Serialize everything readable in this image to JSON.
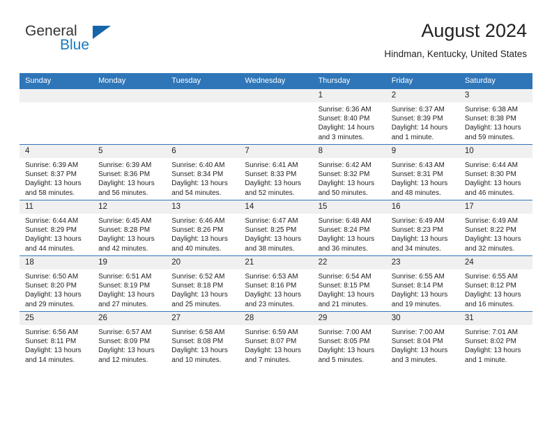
{
  "brand": {
    "name_part1": "General",
    "name_part2": "Blue",
    "triangle_color": "#1565a8",
    "blue_text_color": "#1878be"
  },
  "header": {
    "month_title": "August 2024",
    "location": "Hindman, Kentucky, United States",
    "accent_color": "#2f76b8",
    "daynum_band_color": "#f0f0f0"
  },
  "weekday_headers": [
    "Sunday",
    "Monday",
    "Tuesday",
    "Wednesday",
    "Thursday",
    "Friday",
    "Saturday"
  ],
  "labels": {
    "sunrise_prefix": "Sunrise:",
    "sunset_prefix": "Sunset:",
    "daylight_prefix": "Daylight:"
  },
  "weeks": [
    [
      {
        "day": "",
        "sunrise": "",
        "sunset": "",
        "daylight_line1": "",
        "daylight_line2": ""
      },
      {
        "day": "",
        "sunrise": "",
        "sunset": "",
        "daylight_line1": "",
        "daylight_line2": ""
      },
      {
        "day": "",
        "sunrise": "",
        "sunset": "",
        "daylight_line1": "",
        "daylight_line2": ""
      },
      {
        "day": "",
        "sunrise": "",
        "sunset": "",
        "daylight_line1": "",
        "daylight_line2": ""
      },
      {
        "day": "1",
        "sunrise": "Sunrise: 6:36 AM",
        "sunset": "Sunset: 8:40 PM",
        "daylight_line1": "Daylight: 14 hours",
        "daylight_line2": "and 3 minutes."
      },
      {
        "day": "2",
        "sunrise": "Sunrise: 6:37 AM",
        "sunset": "Sunset: 8:39 PM",
        "daylight_line1": "Daylight: 14 hours",
        "daylight_line2": "and 1 minute."
      },
      {
        "day": "3",
        "sunrise": "Sunrise: 6:38 AM",
        "sunset": "Sunset: 8:38 PM",
        "daylight_line1": "Daylight: 13 hours",
        "daylight_line2": "and 59 minutes."
      }
    ],
    [
      {
        "day": "4",
        "sunrise": "Sunrise: 6:39 AM",
        "sunset": "Sunset: 8:37 PM",
        "daylight_line1": "Daylight: 13 hours",
        "daylight_line2": "and 58 minutes."
      },
      {
        "day": "5",
        "sunrise": "Sunrise: 6:39 AM",
        "sunset": "Sunset: 8:36 PM",
        "daylight_line1": "Daylight: 13 hours",
        "daylight_line2": "and 56 minutes."
      },
      {
        "day": "6",
        "sunrise": "Sunrise: 6:40 AM",
        "sunset": "Sunset: 8:34 PM",
        "daylight_line1": "Daylight: 13 hours",
        "daylight_line2": "and 54 minutes."
      },
      {
        "day": "7",
        "sunrise": "Sunrise: 6:41 AM",
        "sunset": "Sunset: 8:33 PM",
        "daylight_line1": "Daylight: 13 hours",
        "daylight_line2": "and 52 minutes."
      },
      {
        "day": "8",
        "sunrise": "Sunrise: 6:42 AM",
        "sunset": "Sunset: 8:32 PM",
        "daylight_line1": "Daylight: 13 hours",
        "daylight_line2": "and 50 minutes."
      },
      {
        "day": "9",
        "sunrise": "Sunrise: 6:43 AM",
        "sunset": "Sunset: 8:31 PM",
        "daylight_line1": "Daylight: 13 hours",
        "daylight_line2": "and 48 minutes."
      },
      {
        "day": "10",
        "sunrise": "Sunrise: 6:44 AM",
        "sunset": "Sunset: 8:30 PM",
        "daylight_line1": "Daylight: 13 hours",
        "daylight_line2": "and 46 minutes."
      }
    ],
    [
      {
        "day": "11",
        "sunrise": "Sunrise: 6:44 AM",
        "sunset": "Sunset: 8:29 PM",
        "daylight_line1": "Daylight: 13 hours",
        "daylight_line2": "and 44 minutes."
      },
      {
        "day": "12",
        "sunrise": "Sunrise: 6:45 AM",
        "sunset": "Sunset: 8:28 PM",
        "daylight_line1": "Daylight: 13 hours",
        "daylight_line2": "and 42 minutes."
      },
      {
        "day": "13",
        "sunrise": "Sunrise: 6:46 AM",
        "sunset": "Sunset: 8:26 PM",
        "daylight_line1": "Daylight: 13 hours",
        "daylight_line2": "and 40 minutes."
      },
      {
        "day": "14",
        "sunrise": "Sunrise: 6:47 AM",
        "sunset": "Sunset: 8:25 PM",
        "daylight_line1": "Daylight: 13 hours",
        "daylight_line2": "and 38 minutes."
      },
      {
        "day": "15",
        "sunrise": "Sunrise: 6:48 AM",
        "sunset": "Sunset: 8:24 PM",
        "daylight_line1": "Daylight: 13 hours",
        "daylight_line2": "and 36 minutes."
      },
      {
        "day": "16",
        "sunrise": "Sunrise: 6:49 AM",
        "sunset": "Sunset: 8:23 PM",
        "daylight_line1": "Daylight: 13 hours",
        "daylight_line2": "and 34 minutes."
      },
      {
        "day": "17",
        "sunrise": "Sunrise: 6:49 AM",
        "sunset": "Sunset: 8:22 PM",
        "daylight_line1": "Daylight: 13 hours",
        "daylight_line2": "and 32 minutes."
      }
    ],
    [
      {
        "day": "18",
        "sunrise": "Sunrise: 6:50 AM",
        "sunset": "Sunset: 8:20 PM",
        "daylight_line1": "Daylight: 13 hours",
        "daylight_line2": "and 29 minutes."
      },
      {
        "day": "19",
        "sunrise": "Sunrise: 6:51 AM",
        "sunset": "Sunset: 8:19 PM",
        "daylight_line1": "Daylight: 13 hours",
        "daylight_line2": "and 27 minutes."
      },
      {
        "day": "20",
        "sunrise": "Sunrise: 6:52 AM",
        "sunset": "Sunset: 8:18 PM",
        "daylight_line1": "Daylight: 13 hours",
        "daylight_line2": "and 25 minutes."
      },
      {
        "day": "21",
        "sunrise": "Sunrise: 6:53 AM",
        "sunset": "Sunset: 8:16 PM",
        "daylight_line1": "Daylight: 13 hours",
        "daylight_line2": "and 23 minutes."
      },
      {
        "day": "22",
        "sunrise": "Sunrise: 6:54 AM",
        "sunset": "Sunset: 8:15 PM",
        "daylight_line1": "Daylight: 13 hours",
        "daylight_line2": "and 21 minutes."
      },
      {
        "day": "23",
        "sunrise": "Sunrise: 6:55 AM",
        "sunset": "Sunset: 8:14 PM",
        "daylight_line1": "Daylight: 13 hours",
        "daylight_line2": "and 19 minutes."
      },
      {
        "day": "24",
        "sunrise": "Sunrise: 6:55 AM",
        "sunset": "Sunset: 8:12 PM",
        "daylight_line1": "Daylight: 13 hours",
        "daylight_line2": "and 16 minutes."
      }
    ],
    [
      {
        "day": "25",
        "sunrise": "Sunrise: 6:56 AM",
        "sunset": "Sunset: 8:11 PM",
        "daylight_line1": "Daylight: 13 hours",
        "daylight_line2": "and 14 minutes."
      },
      {
        "day": "26",
        "sunrise": "Sunrise: 6:57 AM",
        "sunset": "Sunset: 8:09 PM",
        "daylight_line1": "Daylight: 13 hours",
        "daylight_line2": "and 12 minutes."
      },
      {
        "day": "27",
        "sunrise": "Sunrise: 6:58 AM",
        "sunset": "Sunset: 8:08 PM",
        "daylight_line1": "Daylight: 13 hours",
        "daylight_line2": "and 10 minutes."
      },
      {
        "day": "28",
        "sunrise": "Sunrise: 6:59 AM",
        "sunset": "Sunset: 8:07 PM",
        "daylight_line1": "Daylight: 13 hours",
        "daylight_line2": "and 7 minutes."
      },
      {
        "day": "29",
        "sunrise": "Sunrise: 7:00 AM",
        "sunset": "Sunset: 8:05 PM",
        "daylight_line1": "Daylight: 13 hours",
        "daylight_line2": "and 5 minutes."
      },
      {
        "day": "30",
        "sunrise": "Sunrise: 7:00 AM",
        "sunset": "Sunset: 8:04 PM",
        "daylight_line1": "Daylight: 13 hours",
        "daylight_line2": "and 3 minutes."
      },
      {
        "day": "31",
        "sunrise": "Sunrise: 7:01 AM",
        "sunset": "Sunset: 8:02 PM",
        "daylight_line1": "Daylight: 13 hours",
        "daylight_line2": "and 1 minute."
      }
    ]
  ]
}
